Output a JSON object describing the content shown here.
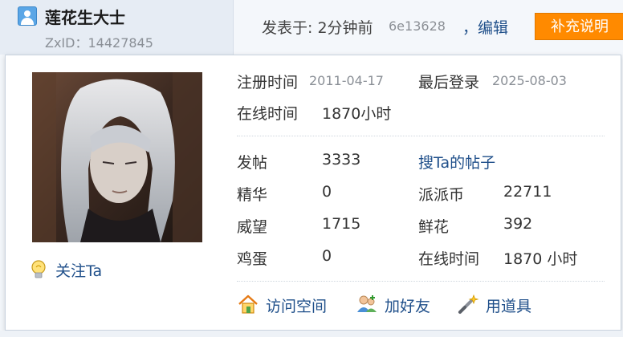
{
  "header": {
    "username": "莲花生大士",
    "zxid": "ZxID：14427845",
    "posted_label": "发表于: 2分钟前",
    "hash": "6e13628",
    "edit_label": "，编辑",
    "supplement_button": "补充说明"
  },
  "card": {
    "follow_label": "关注Ta",
    "register_label": "注册时间",
    "register_date": "2011-04-17",
    "last_login_label": "最后登录",
    "last_login_date": "2025-08-03",
    "online_label": "在线时间",
    "online_value": "1870小时",
    "stats": {
      "posts_label": "发帖",
      "posts_value": "3333",
      "search_posts_link": "搜Ta的帖子",
      "essence_label": "精华",
      "essence_value": "0",
      "coins_label": "派派币",
      "coins_value": "22711",
      "prestige_label": "威望",
      "prestige_value": "1715",
      "flowers_label": "鲜花",
      "flowers_value": "392",
      "eggs_label": "鸡蛋",
      "eggs_value": "0",
      "online2_label": "在线时间",
      "online2_value": "1870 小时"
    },
    "actions": {
      "visit_space": "访问空间",
      "add_friend": "加好友",
      "use_tools": "用道具"
    }
  },
  "colors": {
    "link": "#1f4f8a",
    "accent_button": "#ff8a00",
    "muted": "#8a8f96"
  },
  "icons": [
    "user-icon",
    "lightbulb-icon",
    "home-icon",
    "add-friend-icon",
    "magic-wand-icon"
  ]
}
